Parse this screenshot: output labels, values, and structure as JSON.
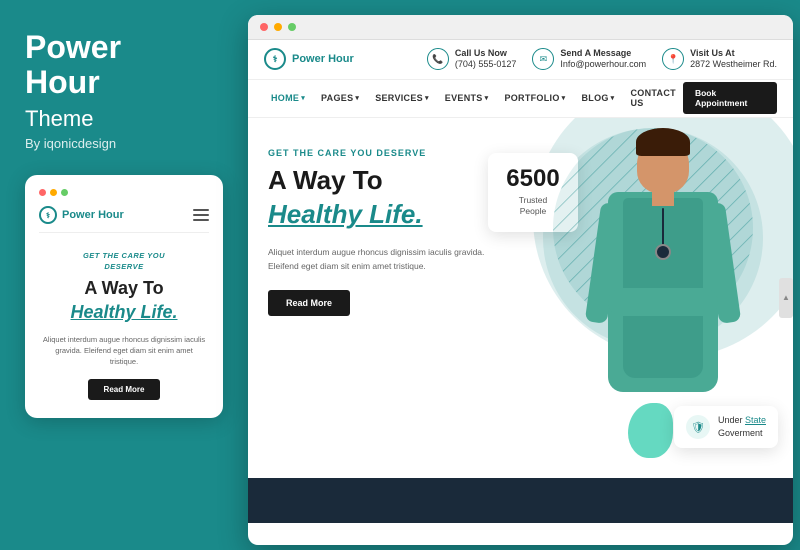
{
  "sidebar": {
    "brand_line1": "Power",
    "brand_line2": "Hour",
    "brand_sub": "Theme",
    "brand_by": "By iqonicdesign"
  },
  "mobile_mockup": {
    "logo_name": "Power Hour",
    "tagline": "GET THE CARE YOU\nDESERVE",
    "heading1": "A Way To",
    "heading2": "Healthy Life.",
    "body_text": "Aliquet interdum augue rhoncus dignissim iaculis gravida. Eleifend eget diam sit enim amet tristique.",
    "cta_label": "Read More"
  },
  "browser": {
    "topbar": {
      "logo": "Power Hour",
      "contact1_label": "Call Us Now",
      "contact1_value": "(704) 555-0127",
      "contact2_label": "Send A Message",
      "contact2_value": "Info@powerhour.com",
      "contact3_label": "Visit Us At",
      "contact3_value": "2872 Westheimer Rd."
    },
    "nav": {
      "items": [
        {
          "label": "HOME",
          "has_dropdown": true
        },
        {
          "label": "PAGES",
          "has_dropdown": true
        },
        {
          "label": "SERVICES",
          "has_dropdown": true
        },
        {
          "label": "EVENTS",
          "has_dropdown": true
        },
        {
          "label": "PORTFOLIO",
          "has_dropdown": true
        },
        {
          "label": "BLOG",
          "has_dropdown": true
        },
        {
          "label": "CONTACT US",
          "has_dropdown": false
        }
      ],
      "cta_label": "Book Appointment"
    },
    "hero": {
      "tagline": "GET THE CARE YOU DESERVE",
      "heading1": "A Way To",
      "heading2": "Healthy Life.",
      "body_text": "Aliquet interdum augue rhoncus dignissim iaculis gravida. Eleifend eget diam sit enim amet tristique.",
      "cta_label": "Read More",
      "stats_number": "6500",
      "stats_label": "Trusted People"
    },
    "gov_badge": {
      "prefix": "Under ",
      "link": "State",
      "suffix": "\nGoverment"
    }
  },
  "colors": {
    "teal": "#1a8a8a",
    "dark": "#1a1a1a",
    "dark_nav": "#1a2a3a"
  }
}
